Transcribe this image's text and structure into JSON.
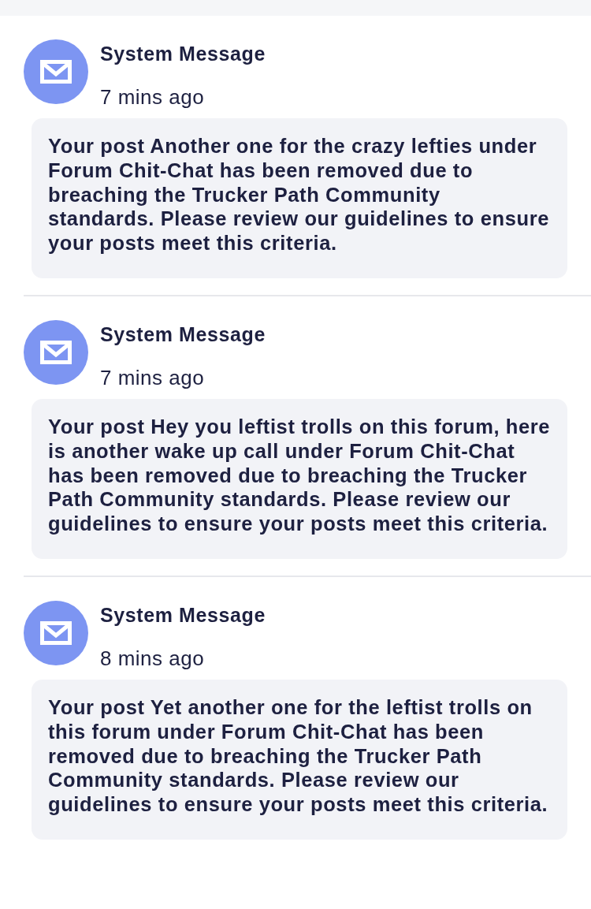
{
  "messages": [
    {
      "title": "System Message",
      "time": "7 mins ago",
      "body": "Your post Another one for the crazy lefties under Forum Chit-Chat has been removed due to breaching the Trucker Path Community standards. Please review our guidelines to ensure your posts meet this criteria."
    },
    {
      "title": "System Message",
      "time": "7 mins ago",
      "body": "Your post Hey you leftist trolls on this forum, here is another wake up call under Forum Chit-Chat has been removed due to breaching the Trucker Path Community standards. Please review our guidelines to ensure your posts meet this criteria."
    },
    {
      "title": "System Message",
      "time": "8 mins ago",
      "body": "Your post Yet another one for the leftist trolls on this forum under Forum Chit-Chat has been removed due to breaching the Trucker Path Community standards. Please review our guidelines to ensure your posts meet this criteria."
    }
  ]
}
